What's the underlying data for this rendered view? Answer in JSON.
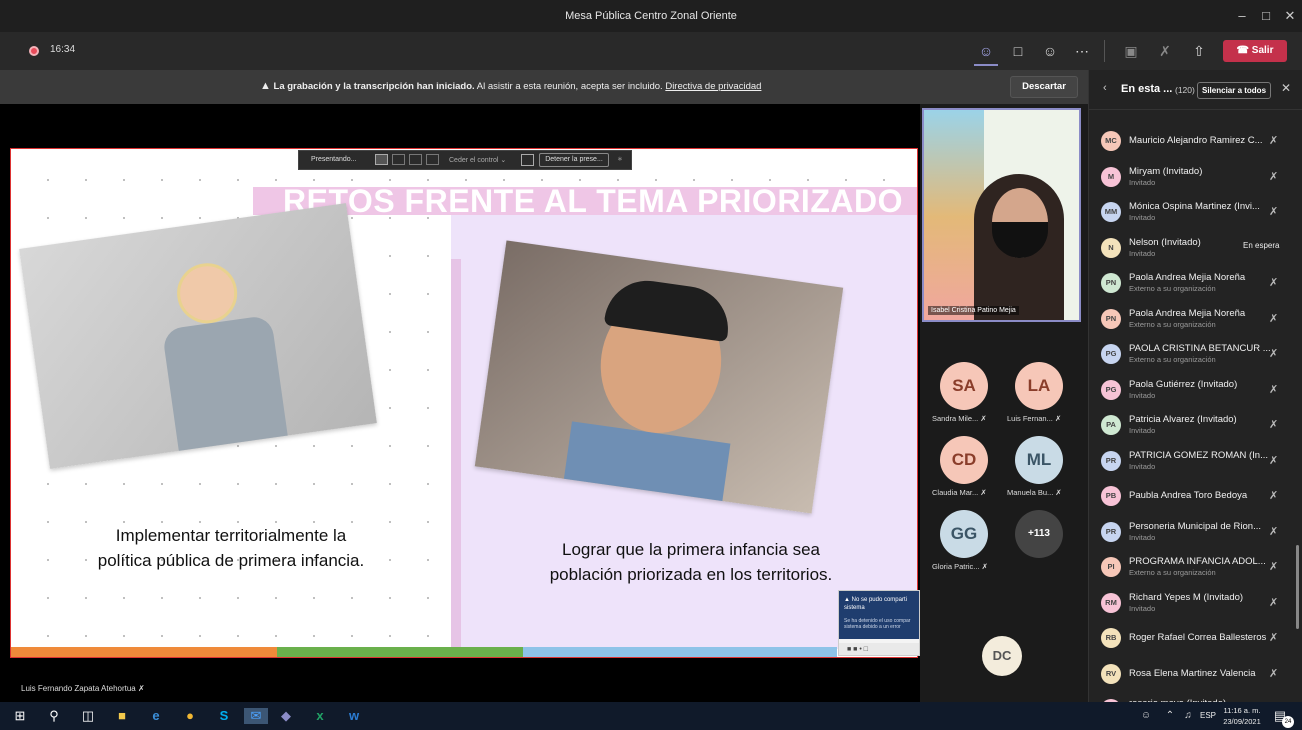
{
  "window": {
    "title": "Mesa Pública Centro Zonal Oriente"
  },
  "toolbar": {
    "timer": "16:34",
    "leave_label": "Salir"
  },
  "banner": {
    "bold_text": "La grabación y la transcripción han iniciado.",
    "text": "Al asistir a esta reunión, acepta ser incluido.",
    "link": "Directiva de privacidad",
    "dismiss_label": "Descartar"
  },
  "presenting_bar": {
    "label": "Presentando...",
    "control_label": "Ceder el control",
    "stop_label": "Detener la prese..."
  },
  "slide": {
    "title": "RETOS FRENTE AL TEMA PRIORIZADO",
    "left_caption_1": "Implementar territorialmente la",
    "left_caption_2": "política pública de primera infancia.",
    "right_caption_1": "Lograr que la primera infancia sea",
    "right_caption_2": "población priorizada en los territorios."
  },
  "error_toast": {
    "title": "No se pudo comparti sistema",
    "body": "Se ha detenido el uso compar sistema debido a un error"
  },
  "presenter": {
    "name": "Luis Fernando Zapata Atehortua"
  },
  "video": {
    "name": "Isabel Cristina Patino Mejia"
  },
  "gallery": [
    {
      "initials": "SA",
      "name": "Sandra Mile...",
      "color": "#f6c7b8"
    },
    {
      "initials": "LA",
      "name": "Luis Fernan...",
      "color": "#f6c7b8"
    },
    {
      "initials": "CD",
      "name": "Claudia Mar...",
      "color": "#f6c7b8"
    },
    {
      "initials": "ML",
      "name": "Manuela Bu...",
      "color": "#c9dbe6"
    },
    {
      "initials": "GG",
      "name": "Gloria Patric...",
      "color": "#c9dbe6"
    }
  ],
  "gallery_more": "+113",
  "gallery_extra": {
    "initials": "DC",
    "color": "#f3ecdc"
  },
  "panel": {
    "title": "En esta ...",
    "count": "(120)",
    "mute_all_label": "Silenciar a todos",
    "participants": [
      {
        "initials": "MC",
        "name": "Mauricio Alejandro Ramirez C...",
        "sub": "",
        "color": "#f6c7b8",
        "status": ""
      },
      {
        "initials": "M",
        "name": "Miryam (Invitado)",
        "sub": "Invitado",
        "color": "#f7c3d6",
        "status": ""
      },
      {
        "initials": "MM",
        "name": "Mónica Ospina Martinez (Invi...",
        "sub": "Invitado",
        "color": "#c7d5f0",
        "status": ""
      },
      {
        "initials": "N",
        "name": "Nelson (Invitado)",
        "sub": "Invitado",
        "color": "#f3e2bb",
        "status": "En espera"
      },
      {
        "initials": "PN",
        "name": "Paola Andrea Mejia Noreña",
        "sub": "Externo a su organización",
        "color": "#cfe8d2",
        "status": ""
      },
      {
        "initials": "PN",
        "name": "Paola Andrea Mejia Noreña",
        "sub": "Externo a su organización",
        "color": "#f6c7b8",
        "status": ""
      },
      {
        "initials": "PG",
        "name": "PAOLA CRISTINA BETANCUR ...",
        "sub": "Externo a su organización",
        "color": "#c7d5f0",
        "status": ""
      },
      {
        "initials": "PG",
        "name": "Paola Gutiérrez (Invitado)",
        "sub": "Invitado",
        "color": "#f7c3d6",
        "status": ""
      },
      {
        "initials": "PA",
        "name": "Patricia Alvarez (Invitado)",
        "sub": "Invitado",
        "color": "#cfe8d2",
        "status": ""
      },
      {
        "initials": "PR",
        "name": "PATRICIA GOMEZ ROMAN (In...",
        "sub": "Invitado",
        "color": "#c7d5f0",
        "status": ""
      },
      {
        "initials": "PB",
        "name": "Paubla Andrea Toro Bedoya",
        "sub": "",
        "color": "#f7c3d6",
        "status": ""
      },
      {
        "initials": "PR",
        "name": "Personeria Municipal de Rion...",
        "sub": "Invitado",
        "color": "#c7d5f0",
        "status": ""
      },
      {
        "initials": "PI",
        "name": "PROGRAMA INFANCIA ADOL...",
        "sub": "Externo a su organización",
        "color": "#f6c7b8",
        "status": ""
      },
      {
        "initials": "RM",
        "name": "Richard Yepes M (Invitado)",
        "sub": "Invitado",
        "color": "#f7c3d6",
        "status": ""
      },
      {
        "initials": "RB",
        "name": "Roger Rafael Correa Ballesteros",
        "sub": "",
        "color": "#f3e2bb",
        "status": ""
      },
      {
        "initials": "RV",
        "name": "Rosa Elena Martinez Valencia",
        "sub": "",
        "color": "#f3e2bb",
        "status": ""
      },
      {
        "initials": "RM",
        "name": "rosario mayo (Invitado)",
        "sub": "Invitado",
        "color": "#f7c3d6",
        "status": ""
      }
    ]
  },
  "taskbar": {
    "lang": "ESP",
    "time": "11:16 a. m.",
    "date": "23/09/2021",
    "notif_count": "24"
  }
}
